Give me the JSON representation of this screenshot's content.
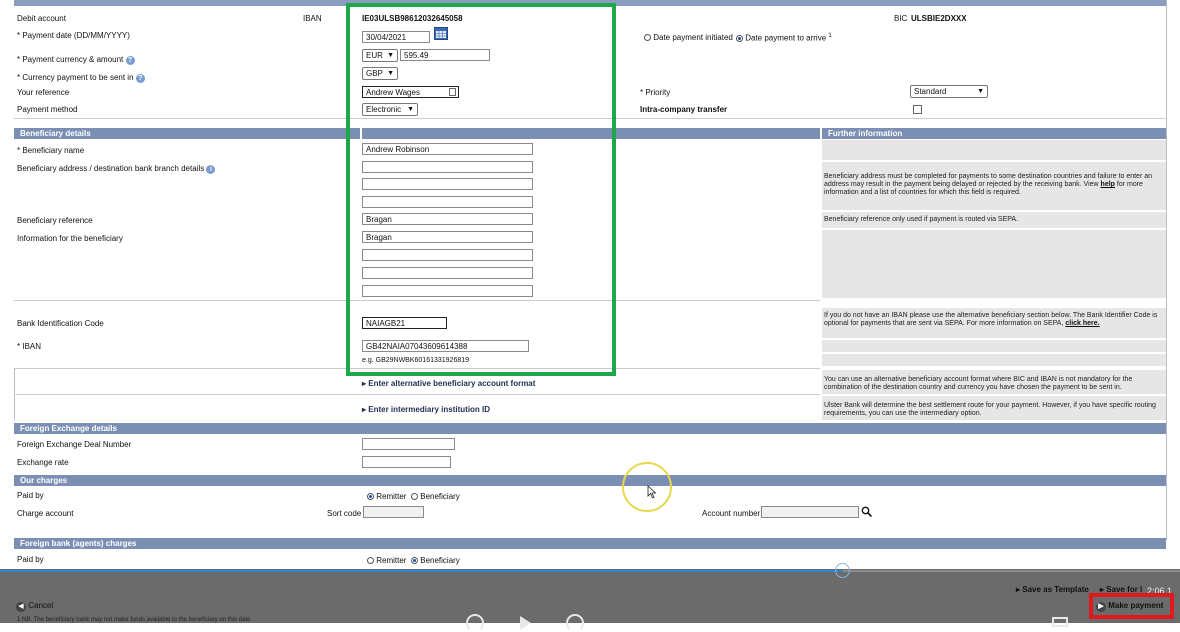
{
  "payment": {
    "debit_account_label": "Debit account",
    "iban_label": "IBAN",
    "iban_value": "IE03ULSB98612032645058",
    "bic_label": "BIC",
    "bic_value": "ULSBIE2DXXX",
    "payment_date_label": "Payment date (DD/MM/YYYY)",
    "payment_date_value": "30/04/2021",
    "date_initiated_label": "Date payment initiated",
    "date_arrive_label": "Date payment to arrive",
    "date_arrive_sup": "1",
    "currency_amount_label": "Payment currency & amount",
    "currency_value": "EUR",
    "amount_value": "595.49",
    "sent_in_label": "Currency payment to be sent in",
    "sent_in_value": "GBP",
    "your_reference_label": "Your reference",
    "your_reference_value": "Andrew Wages",
    "priority_label": "Priority",
    "priority_value": "Standard",
    "method_label": "Payment method",
    "method_value": "Electronic",
    "intra_label": "Intra-company transfer"
  },
  "beneficiary": {
    "header": "Beneficiary details",
    "further_header": "Further information",
    "name_label": "Beneficiary name",
    "name_value": "Andrew Robinson",
    "address_label": "Beneficiary address / destination bank branch details",
    "address_info_pre": "Beneficiary address must be completed for payments to some destination countries and failure to enter an address may result in the payment being delayed or rejected by the receiving bank. View",
    "address_info_link": "help",
    "address_info_post": "for more information and a list of countries for which this field is required.",
    "reference_label": "Beneficiary reference",
    "reference_value": "Bragan",
    "reference_info": "Beneficiary reference only used if payment is routed via SEPA.",
    "information_label": "Information for the beneficiary",
    "information_value": "Bragan",
    "bic_label": "Bank Identification Code",
    "bic_value": "NAIAGB21",
    "iban_label": "IBAN",
    "iban_value": "GB42NAIA07043609614388",
    "iban_example": "e.g.  GB29NWBK60161331926819",
    "bic_info_pre": "If you do not have an IBAN please use the alternative beneficiary section below. The Bank Identifier Code is optional for payments that are sent via SEPA. For more information on SEPA,",
    "bic_info_link": "click here.",
    "alt_format_link": "Enter alternative beneficiary account format",
    "alt_format_info": "You can use an alternative beneficiary account format where BIC and IBAN is not mandatory for the combination of the destination country and currency you have chosen the payment to be sent in.",
    "intermediary_link": "Enter intermediary institution ID",
    "intermediary_info": "Ulster Bank will determine the best settlement route for your payment. However, if you have specific routing requirements, you can use the intermediary option."
  },
  "fx": {
    "header": "Foreign Exchange details",
    "deal_label": "Foreign Exchange Deal Number",
    "rate_label": "Exchange rate"
  },
  "charges": {
    "header": "Our charges",
    "paid_by_label": "Paid by",
    "remitter": "Remitter",
    "beneficiary": "Beneficiary",
    "charge_account_label": "Charge account",
    "sort_code_label": "Sort code",
    "account_number_label": "Account number"
  },
  "agent_charges": {
    "header": "Foreign bank (agents) charges",
    "paid_by_label": "Paid by",
    "remitter": "Remitter",
    "beneficiary": "Beneficiary"
  },
  "footer": {
    "save_template": "Save as Template",
    "save_for_later": "Save for l",
    "cancel": "Cancel",
    "make_payment": "Make payment",
    "footnote": "1 NB. The beneficiary bank may not make funds available to the beneficiary on this date",
    "time_fragment": "2:06 1"
  },
  "colors": {
    "section_header": "#7a8fb3",
    "highlight_green": "#1fa84a",
    "highlight_red": "#e0191f",
    "cursor_ring": "#e6d84a"
  }
}
